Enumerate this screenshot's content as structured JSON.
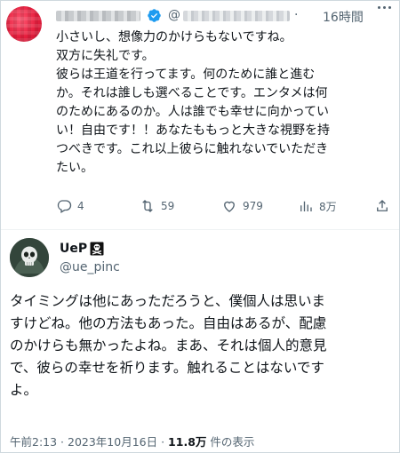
{
  "reply": {
    "handle_prefix": "@",
    "separator": "·",
    "time": "16時間",
    "lines": [
      "小さいし、想像力のかけらもないですね。",
      "双方に失礼です。",
      "彼らは王道を行ってます。何のために誰と進む",
      "か。それは誰しも選べることです。エンタメは何",
      "のためにあるのか。人は誰でも幸せに向かってい",
      "い！自由です！！あなたももっと大きな視野を持",
      "つべきです。これ以上彼らに触れないでいただき",
      "たい。"
    ],
    "actions": {
      "replies": "4",
      "retweets": "59",
      "likes": "979",
      "views": "8万"
    }
  },
  "tweet": {
    "display_name": "UeP",
    "handle": "@ue_pinc",
    "lines": [
      "タイミングは他にあっただろうと、僕個人は思いま",
      "すけどね。他の方法もあった。自由はあるが、配慮",
      "のかけらも無かったよね。まあ、それは個人的意見",
      "で、彼らの幸せを祈ります。触れることはないです",
      "よ。"
    ],
    "timestamp": "午前2:13 · 2023年10月16日 · ",
    "view_count": "11.8万",
    "view_suffix": " 件の表示"
  },
  "colors": {
    "verified_badge": "#1d9bf0",
    "secondary_text": "#536471",
    "primary_text": "#0f1419"
  }
}
